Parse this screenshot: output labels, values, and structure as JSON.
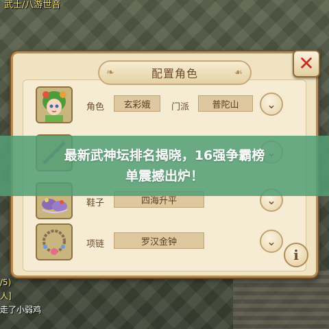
{
  "scene": {
    "top_text": "武士/八游世音",
    "chat_lines": [
      "/5)",
      "人]",
      "走了小弱鸡"
    ]
  },
  "panel": {
    "title": "配置角色",
    "close_icon": "close-x-icon",
    "rows": [
      {
        "label": "角色",
        "value": "玄彩娥",
        "label2": "门派",
        "value2": "普陀山",
        "icon": "character-portrait-icon"
      },
      {
        "label": "",
        "value": "",
        "icon": "weapon-icon"
      },
      {
        "label": "鞋子",
        "value": "四海升平",
        "icon": "shoes-icon"
      },
      {
        "label": "项链",
        "value": "罗汉金钟",
        "icon": "necklace-icon"
      }
    ],
    "info_label": "i"
  },
  "headline": {
    "line1": "最新武神坛排名揭晓，16强争霸榜",
    "line2": "单震撼出炉！"
  },
  "colors": {
    "headline_bg": "#529e76",
    "panel_bg": "#efe3c2",
    "close_x": "#c92a1e"
  }
}
